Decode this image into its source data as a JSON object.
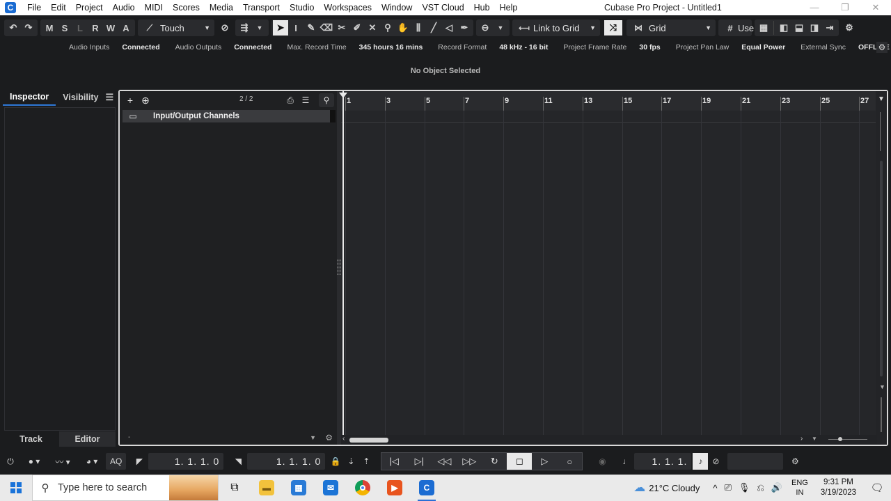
{
  "window": {
    "title": "Cubase Pro Project - Untitled1",
    "controls": [
      "—",
      "❐",
      "✕"
    ]
  },
  "menu": [
    "File",
    "Edit",
    "Project",
    "Audio",
    "MIDI",
    "Scores",
    "Media",
    "Transport",
    "Studio",
    "Workspaces",
    "Window",
    "VST Cloud",
    "Hub",
    "Help"
  ],
  "toolbar": {
    "state_buttons": [
      "M",
      "S",
      "L",
      "R",
      "W",
      "A"
    ],
    "automation_mode": "Touch",
    "snap_link": "Link to Grid",
    "grid_type": "Grid",
    "quantize_label": "Use"
  },
  "status_line": [
    {
      "label": "Audio Inputs",
      "value": "Connected"
    },
    {
      "label": "Audio Outputs",
      "value": "Connected"
    },
    {
      "label": "Max. Record Time",
      "value": "345 hours 16 mins"
    },
    {
      "label": "Record Format",
      "value": "48 kHz - 16 bit"
    },
    {
      "label": "Project Frame Rate",
      "value": "30 fps"
    },
    {
      "label": "Project Pan Law",
      "value": "Equal Power"
    },
    {
      "label": "External Sync",
      "value": "OFFLINE"
    }
  ],
  "info_line": "No Object Selected",
  "inspector": {
    "tabs": [
      "Inspector",
      "Visibility"
    ],
    "active_tab": "Inspector",
    "bottom_tabs": [
      "Track",
      "Editor"
    ],
    "active_bottom": "Editor"
  },
  "track_list": {
    "count": "2 / 2",
    "tracks": [
      {
        "name": "Input/Output Channels",
        "type": "folder"
      }
    ]
  },
  "ruler": {
    "bars": [
      "1",
      "3",
      "5",
      "7",
      "9",
      "11",
      "13",
      "15",
      "17",
      "19",
      "21",
      "23",
      "25",
      "27"
    ]
  },
  "transport": {
    "left_locator": "1. 1. 1.   0",
    "right_locator": "1. 1. 1.   0",
    "primary_time": "1. 1. 1.",
    "quantize_button": "AQ"
  },
  "taskbar": {
    "search_placeholder": "Type here to search",
    "weather": "21°C  Cloudy",
    "lang_top": "ENG",
    "lang_bottom": "IN",
    "time": "9:31 PM",
    "date": "3/19/2023"
  }
}
